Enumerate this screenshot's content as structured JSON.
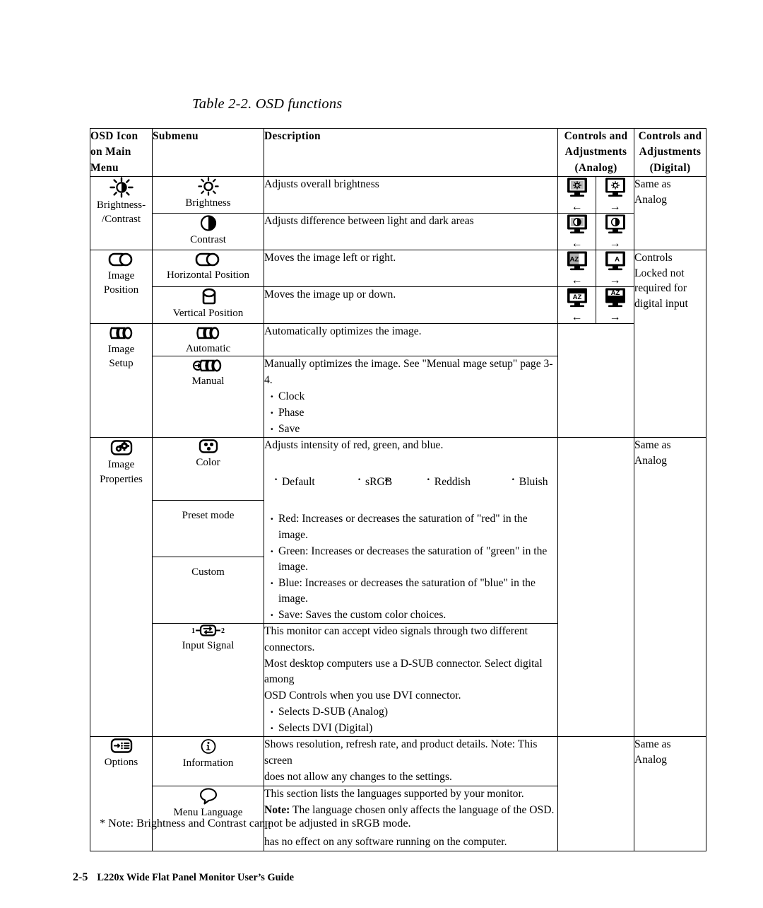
{
  "caption": "Table 2-2. OSD functions",
  "table": {
    "headers": {
      "osd_icon": "OSD Icon on Main Menu",
      "submenu": "Submenu",
      "description": "Description",
      "controls_analog": "Controls and Adjustments (Analog)",
      "controls_digital": "Controls and Adjustments (Digital)"
    },
    "groups": [
      {
        "menu_label_line1": "Brightness-",
        "menu_label_line2": "/Contrast",
        "menu_icon": "brightness-contrast-icon",
        "digital": [
          "Same as",
          "Analog"
        ],
        "rows": [
          {
            "submenu": "Brightness",
            "submenu_icon": "sun-icon",
            "description": "Adjusts overall brightness",
            "ctrl_left_icon": "monitor-brightness-decrease-icon",
            "ctrl_left_arrow": "←",
            "ctrl_right_icon": "monitor-brightness-increase-icon",
            "ctrl_right_arrow": "→"
          },
          {
            "submenu": "Contrast",
            "submenu_icon": "contrast-circle-icon",
            "description": "Adjusts difference between light and dark areas",
            "ctrl_left_icon": "monitor-contrast-decrease-icon",
            "ctrl_left_arrow": "←",
            "ctrl_right_icon": "monitor-contrast-increase-icon",
            "ctrl_right_arrow": "→"
          }
        ]
      },
      {
        "menu_label_line1": "Image",
        "menu_label_line2": "Position",
        "menu_icon": "image-position-icon",
        "digital": [
          "Controls",
          "Locked not",
          "required for",
          "digital input"
        ],
        "rows": [
          {
            "submenu": "Horizontal Position",
            "submenu_icon": "horizontal-position-icon",
            "description": "Moves the image left or right.",
            "ctrl_left_icon": "monitor-hpos-left-icon",
            "ctrl_left_arrow": "←",
            "ctrl_right_icon": "monitor-hpos-right-icon",
            "ctrl_right_arrow": "→"
          },
          {
            "submenu": "Vertical Position",
            "submenu_icon": "vertical-position-icon",
            "description": "Moves the image up or down.",
            "ctrl_left_icon": "monitor-vpos-up-icon",
            "ctrl_left_arrow": "←",
            "ctrl_right_icon": "monitor-vpos-down-icon",
            "ctrl_right_arrow": "→"
          }
        ]
      },
      {
        "menu_label_line1": "Image",
        "menu_label_line2": "Setup",
        "menu_icon": "image-setup-icon",
        "digital": [],
        "rows": [
          {
            "submenu": "Automatic",
            "submenu_icon": "image-setup-auto-icon",
            "description": "Automatically optimizes the image."
          },
          {
            "submenu": "Manual",
            "submenu_icon": "image-setup-manual-icon",
            "description": "Manually optimizes the image. See  \"Menual mage setup\" page 3-4.",
            "bullets": [
              "Clock",
              "Phase",
              "Save"
            ]
          }
        ]
      },
      {
        "menu_label_line1": "Image",
        "menu_label_line2": "Properties",
        "menu_icon": "image-properties-icon",
        "digital": [
          "Same as",
          "Analog"
        ],
        "rows": [
          {
            "submenu": "Color",
            "submenu_icon": "color-dots-icon",
            "description": "Adjusts intensity of red, green, and blue."
          },
          {
            "submenu": "Preset mode",
            "submenu_icon": null,
            "presets": [
              "Default",
              "sRGB",
              "Reddish",
              "Bluish"
            ],
            "preset_star": "*"
          },
          {
            "submenu": "Custom",
            "submenu_icon": null,
            "bullets": [
              "Red: Increases or decreases the saturation of \"red\" in the image.",
              "Green: Increases or decreases the saturation of \"green\" in the image.",
              "Blue: Increases or decreases the saturation of \"blue\"  in the image.",
              "Save: Saves the custom color choices."
            ]
          },
          {
            "submenu": "Input  Signal",
            "submenu_icon": "input-signal-icon",
            "icon_label_left": "1",
            "icon_label_right": "2",
            "paragraphs": [
              "This monitor can accept video signals through two different connectors.",
              "Most desktop computers use a D-SUB connector. Select digital among",
              "OSD Controls when you use DVI connector."
            ],
            "bullets": [
              "Selects D-SUB (Analog)",
              "Selects DVI (Digital)"
            ]
          }
        ]
      },
      {
        "menu_label_line1": "Options",
        "menu_label_line2": "",
        "menu_icon": "options-icon",
        "digital": [
          "Same as",
          "Analog"
        ],
        "rows": [
          {
            "submenu": "Information",
            "submenu_icon": "information-icon",
            "paragraphs": [
              "Shows resolution, refresh rate, and product details. Note: This screen",
              "does not allow any changes to the settings."
            ]
          },
          {
            "submenu": "Menu Language",
            "submenu_icon": "menu-language-icon",
            "paragraphs": [
              "This section lists the languages supported by your monitor."
            ],
            "note_label": "Note:",
            "note_text": " The language chosen only affects the language of the OSD. It",
            "paragraphs_after": [
              "has no effect on any software running on the computer."
            ]
          }
        ]
      }
    ]
  },
  "footnote": "* Note: Brightness and Contrast can not be adjusted in sRGB mode.",
  "footer": {
    "page_number": "2-5",
    "guide_title": "L220x Wide Flat Panel Monitor User’s Guide"
  }
}
